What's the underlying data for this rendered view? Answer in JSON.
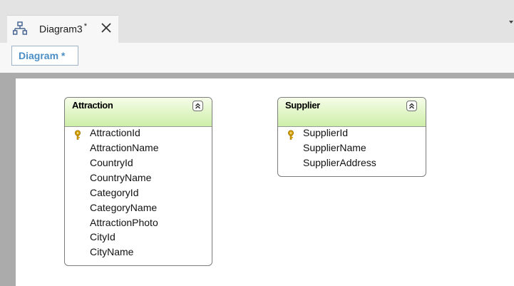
{
  "tab": {
    "title": "Diagram3",
    "modified_marker": "*",
    "icon": "diagram-icon",
    "close_icon": "close-icon"
  },
  "subtab": {
    "label": "Diagram *"
  },
  "entities": [
    {
      "name": "Attraction",
      "attributes": [
        {
          "label": "AttractionId",
          "key": true
        },
        {
          "label": "AttractionName",
          "key": false
        },
        {
          "label": "CountryId",
          "key": false
        },
        {
          "label": "CountryName",
          "key": false
        },
        {
          "label": "CategoryId",
          "key": false
        },
        {
          "label": "CategoryName",
          "key": false
        },
        {
          "label": "AttractionPhoto",
          "key": false
        },
        {
          "label": "CityId",
          "key": false
        },
        {
          "label": "CityName",
          "key": false
        }
      ]
    },
    {
      "name": "Supplier",
      "attributes": [
        {
          "label": "SupplierId",
          "key": true
        },
        {
          "label": "SupplierName",
          "key": false
        },
        {
          "label": "SupplierAddress",
          "key": false
        }
      ]
    }
  ],
  "colors": {
    "entity_header_top": "#f6fde9",
    "entity_header_bottom": "#cdeea8",
    "subtab_text": "#4a8ec5",
    "key_icon": "#d9a200"
  }
}
